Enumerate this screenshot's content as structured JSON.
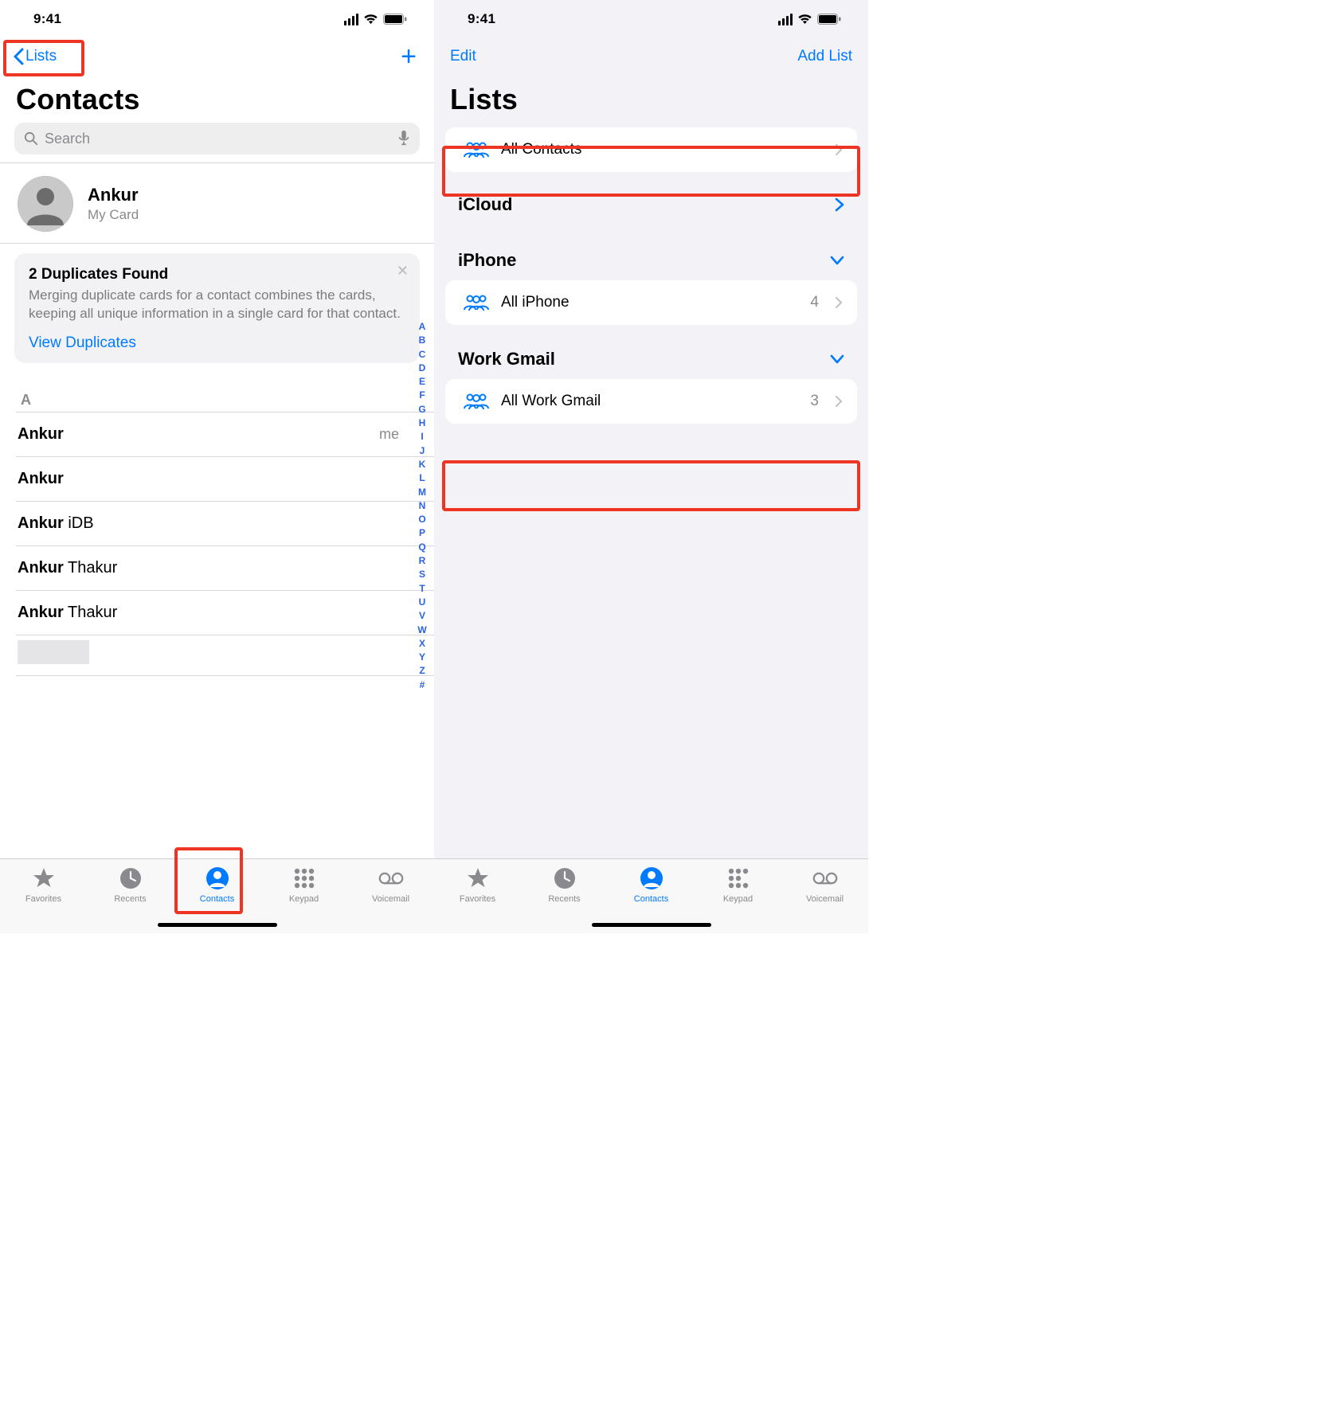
{
  "status_time": "9:41",
  "left": {
    "nav_back_label": "Lists",
    "title": "Contacts",
    "search_placeholder": "Search",
    "mycard": {
      "name": "Ankur",
      "sub": "My Card"
    },
    "duplicates": {
      "title": "2 Duplicates Found",
      "body": "Merging duplicate cards for a contact combines the cards, keeping all unique information in a single card for that contact.",
      "link": "View Duplicates"
    },
    "section_a": "A",
    "contacts": [
      {
        "first": "Ankur",
        "last": "",
        "tag": "me"
      },
      {
        "first": "Ankur",
        "last": ""
      },
      {
        "first": "Ankur",
        "last": "iDB"
      },
      {
        "first": "Ankur",
        "last": "Thakur"
      },
      {
        "first": "Ankur",
        "last": "Thakur"
      }
    ],
    "index_letters": [
      "A",
      "B",
      "C",
      "D",
      "E",
      "F",
      "G",
      "H",
      "I",
      "J",
      "K",
      "L",
      "M",
      "N",
      "O",
      "P",
      "Q",
      "R",
      "S",
      "T",
      "U",
      "V",
      "W",
      "X",
      "Y",
      "Z",
      "#"
    ]
  },
  "right": {
    "nav_edit": "Edit",
    "nav_add": "Add List",
    "title": "Lists",
    "all_contacts": "All Contacts",
    "icloud_hdr": "iCloud",
    "iphone_hdr": "iPhone",
    "all_iphone": {
      "label": "All iPhone",
      "count": "4"
    },
    "work_gmail_hdr": "Work Gmail",
    "all_work_gmail": {
      "label": "All Work Gmail",
      "count": "3"
    }
  },
  "tabs": {
    "favorites": "Favorites",
    "recents": "Recents",
    "contacts": "Contacts",
    "keypad": "Keypad",
    "voicemail": "Voicemail"
  }
}
